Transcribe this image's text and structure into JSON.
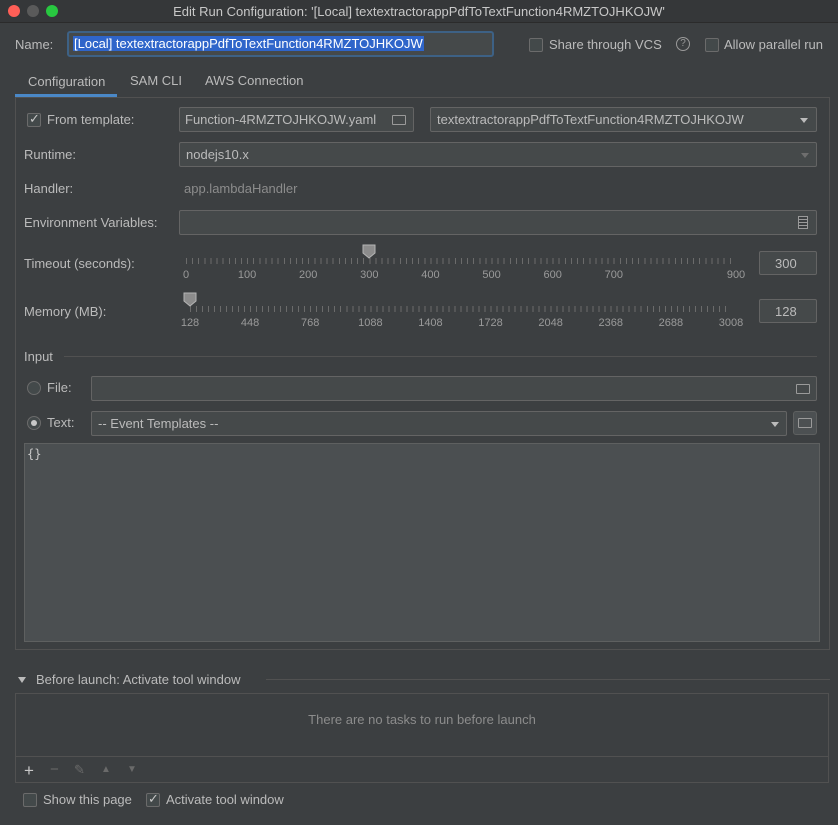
{
  "window": {
    "title": "Edit Run Configuration: '[Local] textextractorappPdfToTextFunction4RMZTOJHKOJW'"
  },
  "name_row": {
    "label": "Name:",
    "value": "[Local] textextractorappPdfToTextFunction4RMZTOJHKOJW",
    "share_label": "Share through VCS",
    "help_glyph": "?",
    "parallel_label": "Allow parallel run"
  },
  "tabs": [
    {
      "label": "Configuration",
      "active": true
    },
    {
      "label": "SAM CLI",
      "active": false
    },
    {
      "label": "AWS Connection",
      "active": false
    }
  ],
  "config": {
    "from_template_label": "From template:",
    "template_file": "Function-4RMZTOJHKOJW.yaml",
    "template_function": "textextractorappPdfToTextFunction4RMZTOJHKOJW",
    "runtime_label": "Runtime:",
    "runtime_value": "nodejs10.x",
    "handler_label": "Handler:",
    "handler_value": "app.lambdaHandler",
    "env_label": "Environment Variables:",
    "env_value": "",
    "timeout_label": "Timeout (seconds):",
    "timeout_value": "300",
    "timeout_ticks": [
      "0",
      "100",
      "200",
      "300",
      "400",
      "500",
      "600",
      "700",
      "900"
    ],
    "timeout_level": 0.333,
    "memory_label": "Memory (MB):",
    "memory_value": "128",
    "memory_ticks": [
      "128",
      "448",
      "768",
      "1088",
      "1408",
      "1728",
      "2048",
      "2368",
      "2688",
      "3008"
    ],
    "memory_level": 0.0
  },
  "input": {
    "section_label": "Input",
    "file_label": "File:",
    "file_value": "",
    "text_label": "Text:",
    "event_templates": "-- Event Templates --",
    "editor_content": "{}"
  },
  "before_launch": {
    "header": "Before launch: Activate tool window",
    "empty_message": "There are no tasks to run before launch",
    "toolbar": {
      "add": "+",
      "remove": "−",
      "edit": "✎",
      "up": "▲",
      "down": "▼"
    }
  },
  "footer": {
    "show_page_label": "Show this page",
    "activate_label": "Activate tool window"
  },
  "colors": {
    "accent": "#4a88c7",
    "selection": "#2f65ca",
    "background": "#3c3f41"
  }
}
